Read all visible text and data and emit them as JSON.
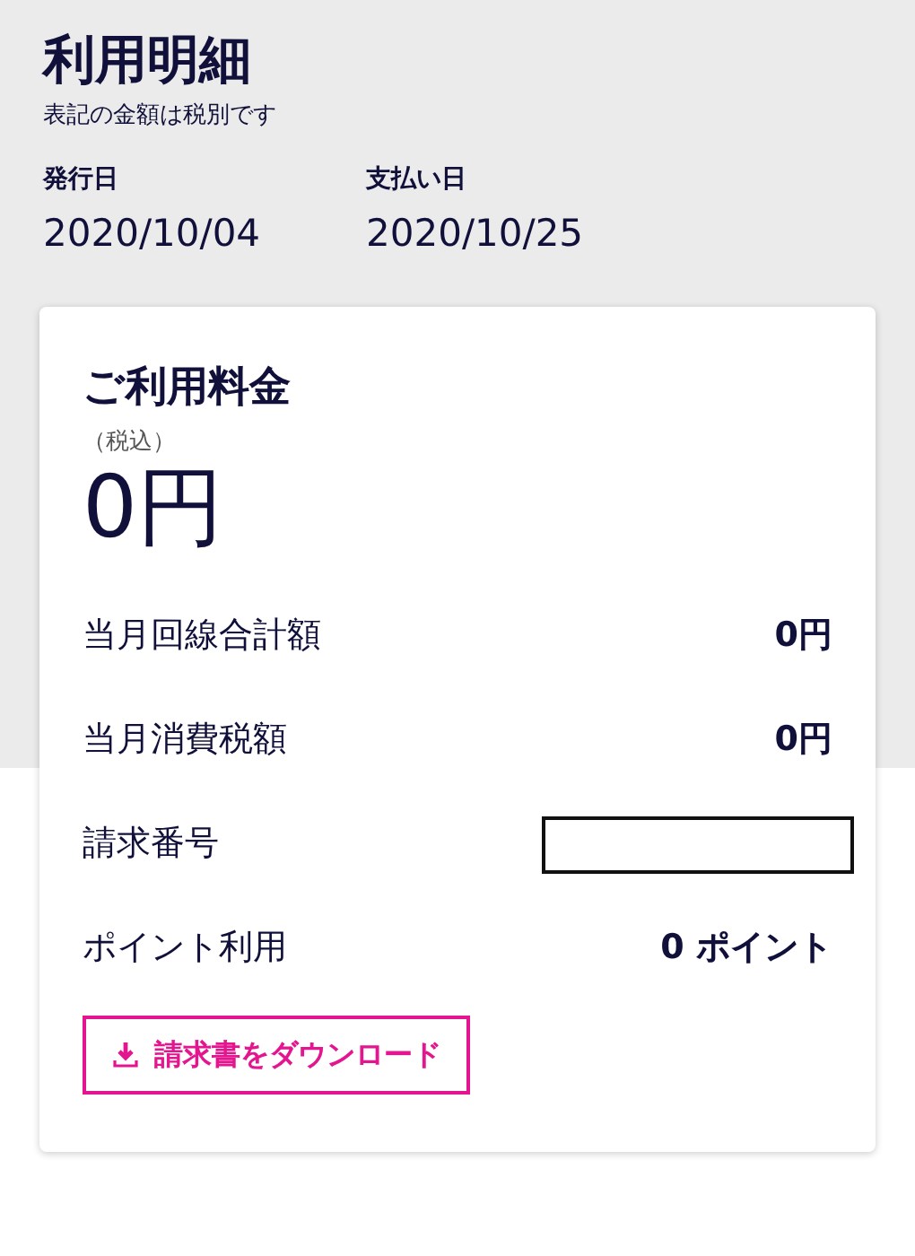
{
  "header": {
    "title": "利用明細",
    "note": "表記の金額は税別です"
  },
  "dates": [
    {
      "label": "発行日",
      "value": "2020/10/04"
    },
    {
      "label": "支払い日",
      "value": "2020/10/25"
    }
  ],
  "summary": {
    "title": "ご利用料金",
    "tax_note": "（税込）",
    "total": "0円",
    "rows": [
      {
        "kind": "value",
        "label": "当月回線合計額",
        "value": "0円"
      },
      {
        "kind": "value",
        "label": "当月消費税額",
        "value": "0円"
      },
      {
        "kind": "redacted",
        "label": "請求番号"
      },
      {
        "kind": "value",
        "label": "ポイント利用",
        "value": "0 ポイント"
      }
    ],
    "download_button": "請求書をダウンロード"
  }
}
